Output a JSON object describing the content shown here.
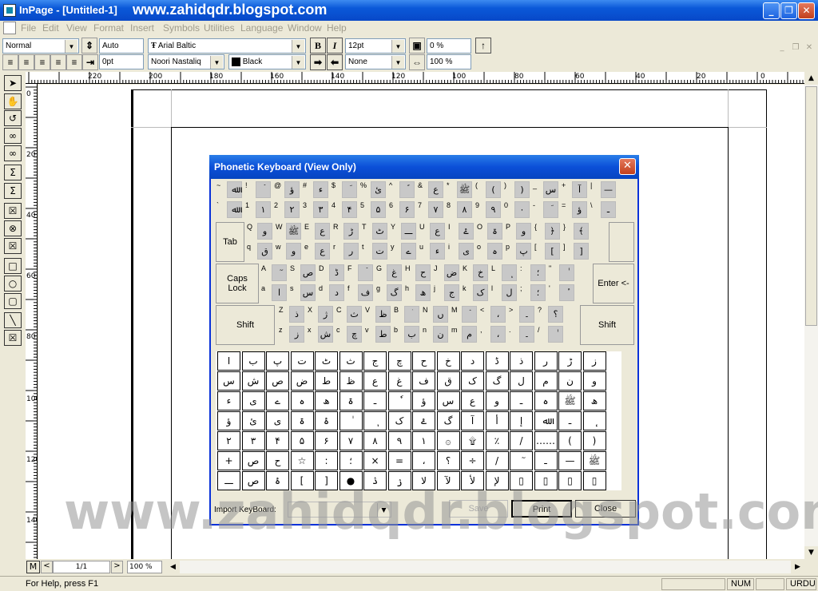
{
  "window": {
    "title": "InPage - [Untitled-1]",
    "watermark_top": "www.zahidqdr.blogspot.com"
  },
  "menu": [
    "File",
    "Edit",
    "View",
    "Format",
    "Insert",
    "Symbols",
    "Utilities",
    "Language",
    "Window",
    "Help"
  ],
  "toolbar": {
    "style": "Normal",
    "leading": "Auto",
    "font_latin": "Arial Baltic",
    "font_size": "12pt",
    "tracking": "0 %",
    "indent": "0pt",
    "font_urdu": "Noori Nastaliq",
    "color": "Black",
    "none": "None",
    "scale": "100 %",
    "bold": "B",
    "italic": "I"
  },
  "ruler_h": [
    "220",
    "200",
    "180",
    "160",
    "140",
    "120",
    "100",
    "80",
    "60",
    "40",
    "20",
    "0"
  ],
  "ruler_v": [
    "0",
    "20",
    "40",
    "60",
    "80",
    "100",
    "120",
    "140"
  ],
  "page_nav": {
    "page": "1/1",
    "zoom": "100 %",
    "m": "M"
  },
  "status": {
    "help": "For Help, press F1",
    "num": "NUM",
    "lang": "URDU"
  },
  "dialog": {
    "title": "Phonetic Keyboard (View Only)",
    "tab": "Tab",
    "caps": "Caps\nLock",
    "enter": "Enter <-",
    "shift": "Shift",
    "import_label": "Import KeyBoard:",
    "save": "Save",
    "print": "Print",
    "close": "Close",
    "row1_top": [
      "~",
      "!",
      "@",
      "#",
      "$",
      "%",
      "^",
      "&",
      "*",
      "(",
      ")",
      "_",
      "+",
      "|"
    ],
    "row1_bot": [
      "`",
      "1",
      "2",
      "3",
      "4",
      "5",
      "6",
      "7",
      "8",
      "9",
      "0",
      "-",
      "=",
      "\\"
    ],
    "row1_top_u": [
      "ﷲ",
      "ۡ",
      "ؤ",
      "ء",
      "ؔ",
      "ئ",
      "ؐ",
      "ع",
      "ﷺ",
      "(",
      ")",
      "س",
      "آ",
      "—"
    ],
    "row1_bot_u": [
      "ﷲ",
      "۱",
      "۲",
      "۳",
      "۴",
      "۵",
      "۶",
      "۷",
      "۸",
      "۹",
      "۰",
      "ؔ",
      "ؤ",
      "ـ"
    ],
    "row2_top": [
      "Q",
      "W",
      "E",
      "R",
      "T",
      "Y",
      "U",
      "I",
      "O",
      "P",
      "{",
      "}"
    ],
    "row2_bot": [
      "q",
      "w",
      "e",
      "r",
      "t",
      "y",
      "u",
      "i",
      "o",
      "p",
      "[",
      "]"
    ],
    "row2_top_u": [
      "و",
      "ﷺ",
      "ع",
      "ڑ",
      "ٹ",
      "ـــ",
      "ع",
      "ۓ",
      "ۃ",
      "و",
      "﴿",
      "﴾"
    ],
    "row2_bot_u": [
      "ق",
      "و",
      "ع",
      "ر",
      "ت",
      "ے",
      "ء",
      "ی",
      "ہ",
      "پ",
      "[",
      "]"
    ],
    "row3_top": [
      "A",
      "S",
      "D",
      "F",
      "G",
      "H",
      "J",
      "K",
      "L",
      ":",
      "\""
    ],
    "row3_bot": [
      "a",
      "s",
      "d",
      "f",
      "g",
      "h",
      "j",
      "k",
      "l",
      ";",
      "'"
    ],
    "row3_top_u": [
      "ٓ",
      "ص",
      "ڈ",
      "ۡ",
      "غ",
      "ح",
      "ض",
      "خ",
      "ٖ",
      "؛",
      "ٰ"
    ],
    "row3_bot_u": [
      "ا",
      "س",
      "د",
      "ف",
      "گ",
      "ھ",
      "ج",
      "ک",
      "ل",
      "؛",
      "ٔ"
    ],
    "row4_top": [
      "Z",
      "X",
      "C",
      "V",
      "B",
      "N",
      "M",
      "<",
      ">",
      "?"
    ],
    "row4_bot": [
      "z",
      "x",
      "c",
      "v",
      "b",
      "n",
      "m",
      ",",
      ".",
      "/"
    ],
    "row4_top_u": [
      "ذ",
      "ژ",
      "ث",
      "ظ",
      "ۛ",
      "ں",
      "ۘ",
      "،",
      "۔",
      "؟"
    ],
    "row4_bot_u": [
      "ز",
      "ش",
      "چ",
      "ط",
      "ب",
      "ن",
      "م",
      "،",
      "۔",
      "ٰ"
    ],
    "chars": [
      [
        "ا",
        "ب",
        "پ",
        "ت",
        "ٹ",
        "ث",
        "ج",
        "چ",
        "ح",
        "خ",
        "د",
        "ڈ",
        "ذ",
        "ر",
        "ڑ",
        "ز"
      ],
      [
        "س",
        "ش",
        "ص",
        "ض",
        "ط",
        "ظ",
        "ع",
        "غ",
        "ف",
        "ق",
        "ک",
        "گ",
        "ل",
        "م",
        "ن",
        "و"
      ],
      [
        "ء",
        "ی",
        "ے",
        "ہ",
        "ھ",
        "ۃ",
        "ـ",
        "ٗ",
        "ؤ",
        "س",
        "ع",
        "و",
        "ـ",
        "ہ",
        "ﷺ",
        "ھ"
      ],
      [
        "ؤ",
        "ئ",
        "ی",
        "ۃ",
        "ۂ",
        "ٰ",
        "ٖ",
        "ک",
        "ۓ",
        "گ",
        "آ",
        "أ",
        "إ",
        "ﷲ",
        "ـ",
        "ٕ"
      ],
      [
        "۲",
        "۳",
        "۴",
        "۵",
        "۶",
        "۷",
        "۸",
        "۹",
        "۱",
        "۞",
        "۩",
        "٪",
        "/",
        "……",
        "(",
        ")"
      ],
      [
        "+",
        "ص",
        "ح",
        "☆",
        ":",
        "؛",
        "×",
        "=",
        "،",
        "؟",
        "÷",
        "/",
        "ٓ",
        "ـ",
        "—",
        "ﷺ"
      ],
      [
        "ـــ",
        "ص",
        "ۂ",
        "[",
        "]",
        "●",
        "ۮ",
        "ۯ",
        "لا",
        "لآ",
        "لأ",
        "لإ",
        "▯",
        "▯",
        "▯",
        "▯"
      ]
    ]
  },
  "watermark": "www.zahidqdr.blogspot.com"
}
